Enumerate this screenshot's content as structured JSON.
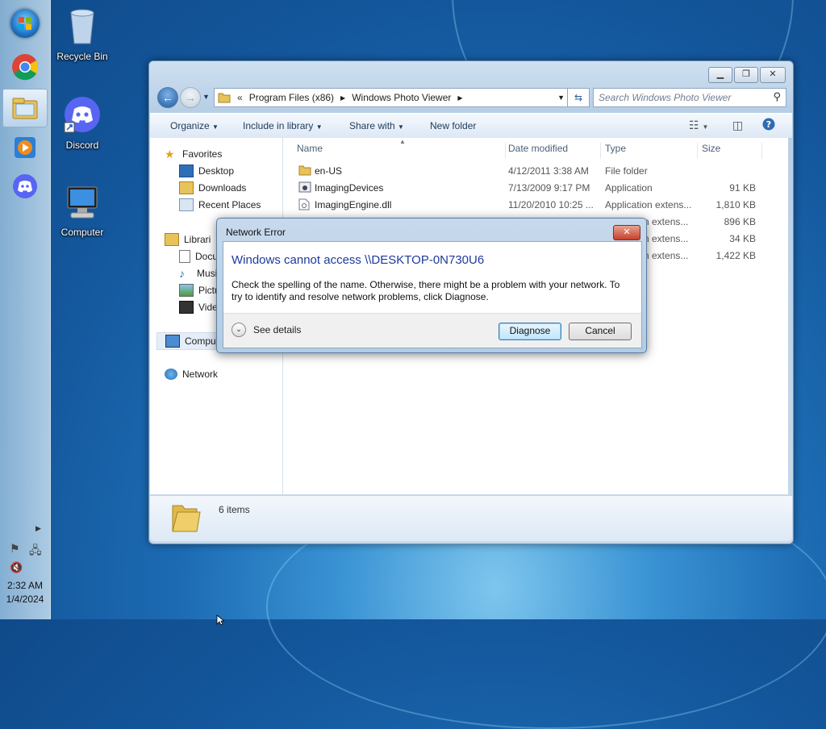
{
  "desktop": {
    "icons": [
      {
        "label": "Recycle Bin",
        "icon": "recycle-bin-icon"
      },
      {
        "label": "Discord",
        "icon": "discord-icon"
      },
      {
        "label": "Computer",
        "icon": "computer-icon"
      }
    ]
  },
  "taskbar": {
    "items": [
      "start-orb",
      "chrome-icon",
      "explorer-icon",
      "media-player-icon",
      "discord-icon"
    ],
    "tray": {
      "time": "2:32 AM",
      "date": "1/4/2024"
    }
  },
  "explorer": {
    "breadcrumb": [
      "«",
      "Program Files (x86)",
      "Windows Photo Viewer"
    ],
    "search_placeholder": "Search Windows Photo Viewer",
    "toolbar": [
      "Organize",
      "Include in library",
      "Share with",
      "New folder"
    ],
    "nav": {
      "favorites_label": "Favorites",
      "favorites": [
        "Desktop",
        "Downloads",
        "Recent Places"
      ],
      "libraries_label": "Librari",
      "libraries": [
        "Docu",
        "Musi",
        "Pictu",
        "Vide"
      ],
      "computer_label": "Compu",
      "network_label": "Network"
    },
    "columns": [
      "Name",
      "Date modified",
      "Type",
      "Size"
    ],
    "files": [
      {
        "name": "en-US",
        "date": "4/12/2011 3:38 AM",
        "type": "File folder",
        "size": "",
        "icon": "folder-icon"
      },
      {
        "name": "ImagingDevices",
        "date": "7/13/2009 9:17 PM",
        "type": "Application",
        "size": "91 KB",
        "icon": "app-icon"
      },
      {
        "name": "ImagingEngine.dll",
        "date": "11/20/2010 10:25 ...",
        "type": "Application extens...",
        "size": "1,810 KB",
        "icon": "dll-icon"
      },
      {
        "name": "",
        "date": "",
        "type": "n extens...",
        "size": "896 KB",
        "icon": "dll-icon"
      },
      {
        "name": "",
        "date": "",
        "type": "n extens...",
        "size": "34 KB",
        "icon": "dll-icon"
      },
      {
        "name": "",
        "date": "",
        "type": "n extens...",
        "size": "1,422 KB",
        "icon": "dll-icon"
      }
    ],
    "status_text": "6 items"
  },
  "dialog": {
    "title": "Network Error",
    "heading": "Windows cannot access \\\\DESKTOP-0N730U6",
    "body": "Check the spelling of the name. Otherwise, there might be a problem with your network. To try to identify and resolve network problems, click Diagnose.",
    "see_details": "See details",
    "diagnose": "Diagnose",
    "cancel": "Cancel"
  }
}
